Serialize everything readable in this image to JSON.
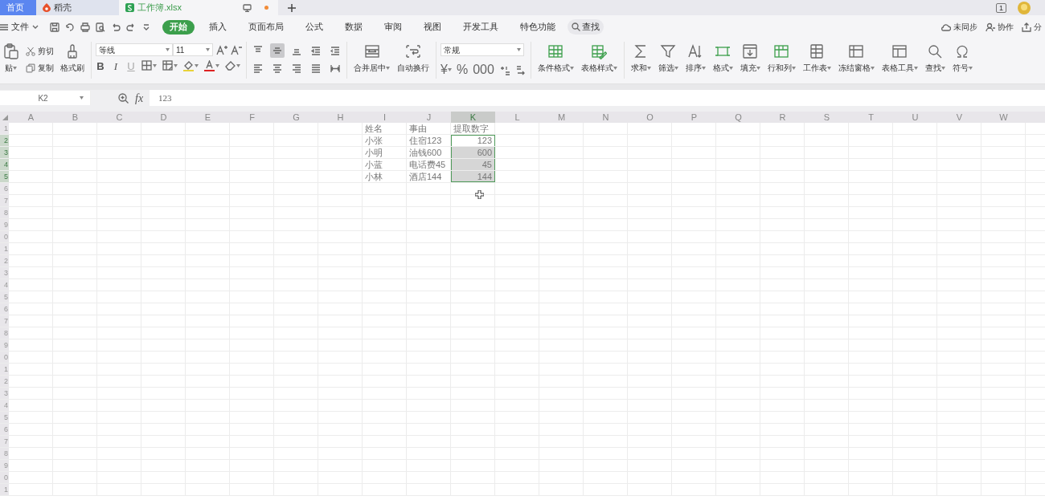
{
  "doc_tabs": [
    {
      "label": "首页",
      "kind": "home",
      "selected": false,
      "modified": false
    },
    {
      "label": "稻壳",
      "kind": "app",
      "selected": false,
      "modified": false
    },
    {
      "label": "工作簿.xlsx",
      "kind": "file",
      "selected": true,
      "modified": true
    }
  ],
  "title_right": {
    "window_count": "1"
  },
  "menu": {
    "file": "文件",
    "tabs": [
      {
        "label": "开始",
        "selected": true
      },
      {
        "label": "插入",
        "selected": false
      },
      {
        "label": "页面布局",
        "selected": false
      },
      {
        "label": "公式",
        "selected": false
      },
      {
        "label": "数据",
        "selected": false
      },
      {
        "label": "审阅",
        "selected": false
      },
      {
        "label": "视图",
        "selected": false
      },
      {
        "label": "开发工具",
        "selected": false
      },
      {
        "label": "特色功能",
        "selected": false
      }
    ],
    "search": "查找",
    "right": [
      "未同步",
      "协作",
      "分"
    ]
  },
  "ribbon": {
    "groups": [
      {
        "kind": "items",
        "items": [
          {
            "kind": "large",
            "label": "贴",
            "dropdown": true
          },
          {
            "kind": "small",
            "label": "剪切",
            "dropdown": false
          },
          {
            "kind": "small",
            "label": "复制",
            "dropdown": false
          },
          {
            "kind": "large",
            "label": "格式刷",
            "dropdown": false
          }
        ]
      },
      {
        "kind": "font",
        "font_name": "等线",
        "font_size": "11",
        "styles": [
          "B",
          "I",
          "U"
        ]
      },
      {
        "kind": "align",
        "buttons": [
          {
            "selected": false
          },
          {
            "selected": true
          },
          {
            "selected": false
          },
          {
            "selected": false
          },
          {
            "selected": false
          },
          {
            "selected": false
          },
          {
            "selected": false
          },
          {
            "selected": false
          },
          {
            "selected": false
          },
          {
            "selected": false
          }
        ]
      },
      {
        "kind": "items",
        "items": [
          {
            "kind": "large",
            "label": "合并居中",
            "dropdown": true
          },
          {
            "kind": "large",
            "label": "自动换行",
            "dropdown": false
          }
        ]
      },
      {
        "kind": "number",
        "format": "常规",
        "symbols": [
          "¥",
          "%",
          "000"
        ]
      },
      {
        "kind": "items",
        "items": [
          {
            "kind": "large",
            "label": "条件格式",
            "dropdown": true
          },
          {
            "kind": "large",
            "label": "表格样式",
            "dropdown": true
          }
        ]
      },
      {
        "kind": "items",
        "items": [
          {
            "kind": "large",
            "label": "求和",
            "dropdown": true
          },
          {
            "kind": "large",
            "label": "筛选",
            "dropdown": true
          },
          {
            "kind": "large",
            "label": "排序",
            "dropdown": true
          },
          {
            "kind": "large",
            "label": "格式",
            "dropdown": true
          },
          {
            "kind": "large",
            "label": "填充",
            "dropdown": true
          },
          {
            "kind": "large",
            "label": "行和列",
            "dropdown": true
          },
          {
            "kind": "large",
            "label": "工作表",
            "dropdown": true
          },
          {
            "kind": "large",
            "label": "冻结窗格",
            "dropdown": true
          },
          {
            "kind": "large",
            "label": "表格工具",
            "dropdown": true
          },
          {
            "kind": "large",
            "label": "查找",
            "dropdown": true
          },
          {
            "kind": "large",
            "label": "符号",
            "dropdown": true
          }
        ]
      }
    ]
  },
  "formula_bar": {
    "cell_ref": "K2",
    "fx": "fx",
    "value": "123"
  },
  "sheet": {
    "columns": [
      {
        "label": "A",
        "selected": false
      },
      {
        "label": "B",
        "selected": false
      },
      {
        "label": "C",
        "selected": false
      },
      {
        "label": "D",
        "selected": false
      },
      {
        "label": "E",
        "selected": false
      },
      {
        "label": "F",
        "selected": false
      },
      {
        "label": "G",
        "selected": false
      },
      {
        "label": "H",
        "selected": false
      },
      {
        "label": "I",
        "selected": false,
        "cells": [
          {
            "text": "姓名",
            "kind": "text",
            "selected": false,
            "active": false
          },
          {
            "text": "小张",
            "kind": "text",
            "selected": false,
            "active": false
          },
          {
            "text": "小明",
            "kind": "text",
            "selected": false,
            "active": false
          },
          {
            "text": "小蓝",
            "kind": "text",
            "selected": false,
            "active": false
          },
          {
            "text": "小林",
            "kind": "text",
            "selected": false,
            "active": false
          }
        ]
      },
      {
        "label": "J",
        "selected": false,
        "cells": [
          {
            "text": "事由",
            "kind": "text",
            "selected": false,
            "active": false
          },
          {
            "text": "住宿123",
            "kind": "text",
            "selected": false,
            "active": false
          },
          {
            "text": "油钱600",
            "kind": "text",
            "selected": false,
            "active": false
          },
          {
            "text": "电话费45",
            "kind": "text",
            "selected": false,
            "active": false
          },
          {
            "text": "酒店144",
            "kind": "text",
            "selected": false,
            "active": false
          }
        ]
      },
      {
        "label": "K",
        "selected": true,
        "cells": [
          {
            "text": "提取数字",
            "kind": "text",
            "selected": false,
            "active": false
          },
          {
            "text": "123",
            "kind": "number",
            "selected": true,
            "active": true
          },
          {
            "text": "600",
            "kind": "number",
            "selected": true,
            "active": false
          },
          {
            "text": "45",
            "kind": "number",
            "selected": true,
            "active": false
          },
          {
            "text": "144",
            "kind": "number",
            "selected": true,
            "active": false
          }
        ]
      },
      {
        "label": "L",
        "selected": false
      },
      {
        "label": "M",
        "selected": false
      },
      {
        "label": "N",
        "selected": false
      },
      {
        "label": "O",
        "selected": false
      },
      {
        "label": "P",
        "selected": false
      },
      {
        "label": "Q",
        "selected": false
      },
      {
        "label": "R",
        "selected": false
      },
      {
        "label": "S",
        "selected": false
      },
      {
        "label": "T",
        "selected": false
      },
      {
        "label": "U",
        "selected": false
      },
      {
        "label": "V",
        "selected": false
      },
      {
        "label": "W",
        "selected": false
      }
    ],
    "rows": [
      {
        "header": "1",
        "selected": false
      },
      {
        "header": "2",
        "selected": true
      },
      {
        "header": "3",
        "selected": true
      },
      {
        "header": "4",
        "selected": true
      },
      {
        "header": "5",
        "selected": true
      },
      {
        "header": "6",
        "selected": false
      },
      {
        "header": "7",
        "selected": false
      },
      {
        "header": "8",
        "selected": false
      },
      {
        "header": "9",
        "selected": false
      },
      {
        "header": "0",
        "selected": false
      },
      {
        "header": "1",
        "selected": false
      },
      {
        "header": "2",
        "selected": false
      },
      {
        "header": "3",
        "selected": false
      },
      {
        "header": "4",
        "selected": false
      },
      {
        "header": "5",
        "selected": false
      },
      {
        "header": "6",
        "selected": false
      },
      {
        "header": "7",
        "selected": false
      },
      {
        "header": "8",
        "selected": false
      },
      {
        "header": "9",
        "selected": false
      },
      {
        "header": "0",
        "selected": false
      },
      {
        "header": "1",
        "selected": false
      },
      {
        "header": "2",
        "selected": false
      },
      {
        "header": "3",
        "selected": false
      },
      {
        "header": "4",
        "selected": false
      },
      {
        "header": "5",
        "selected": false
      },
      {
        "header": "6",
        "selected": false
      },
      {
        "header": "7",
        "selected": false
      },
      {
        "header": "8",
        "selected": false
      },
      {
        "header": "9",
        "selected": false
      },
      {
        "header": "0",
        "selected": false
      },
      {
        "header": "1",
        "selected": false
      }
    ]
  }
}
